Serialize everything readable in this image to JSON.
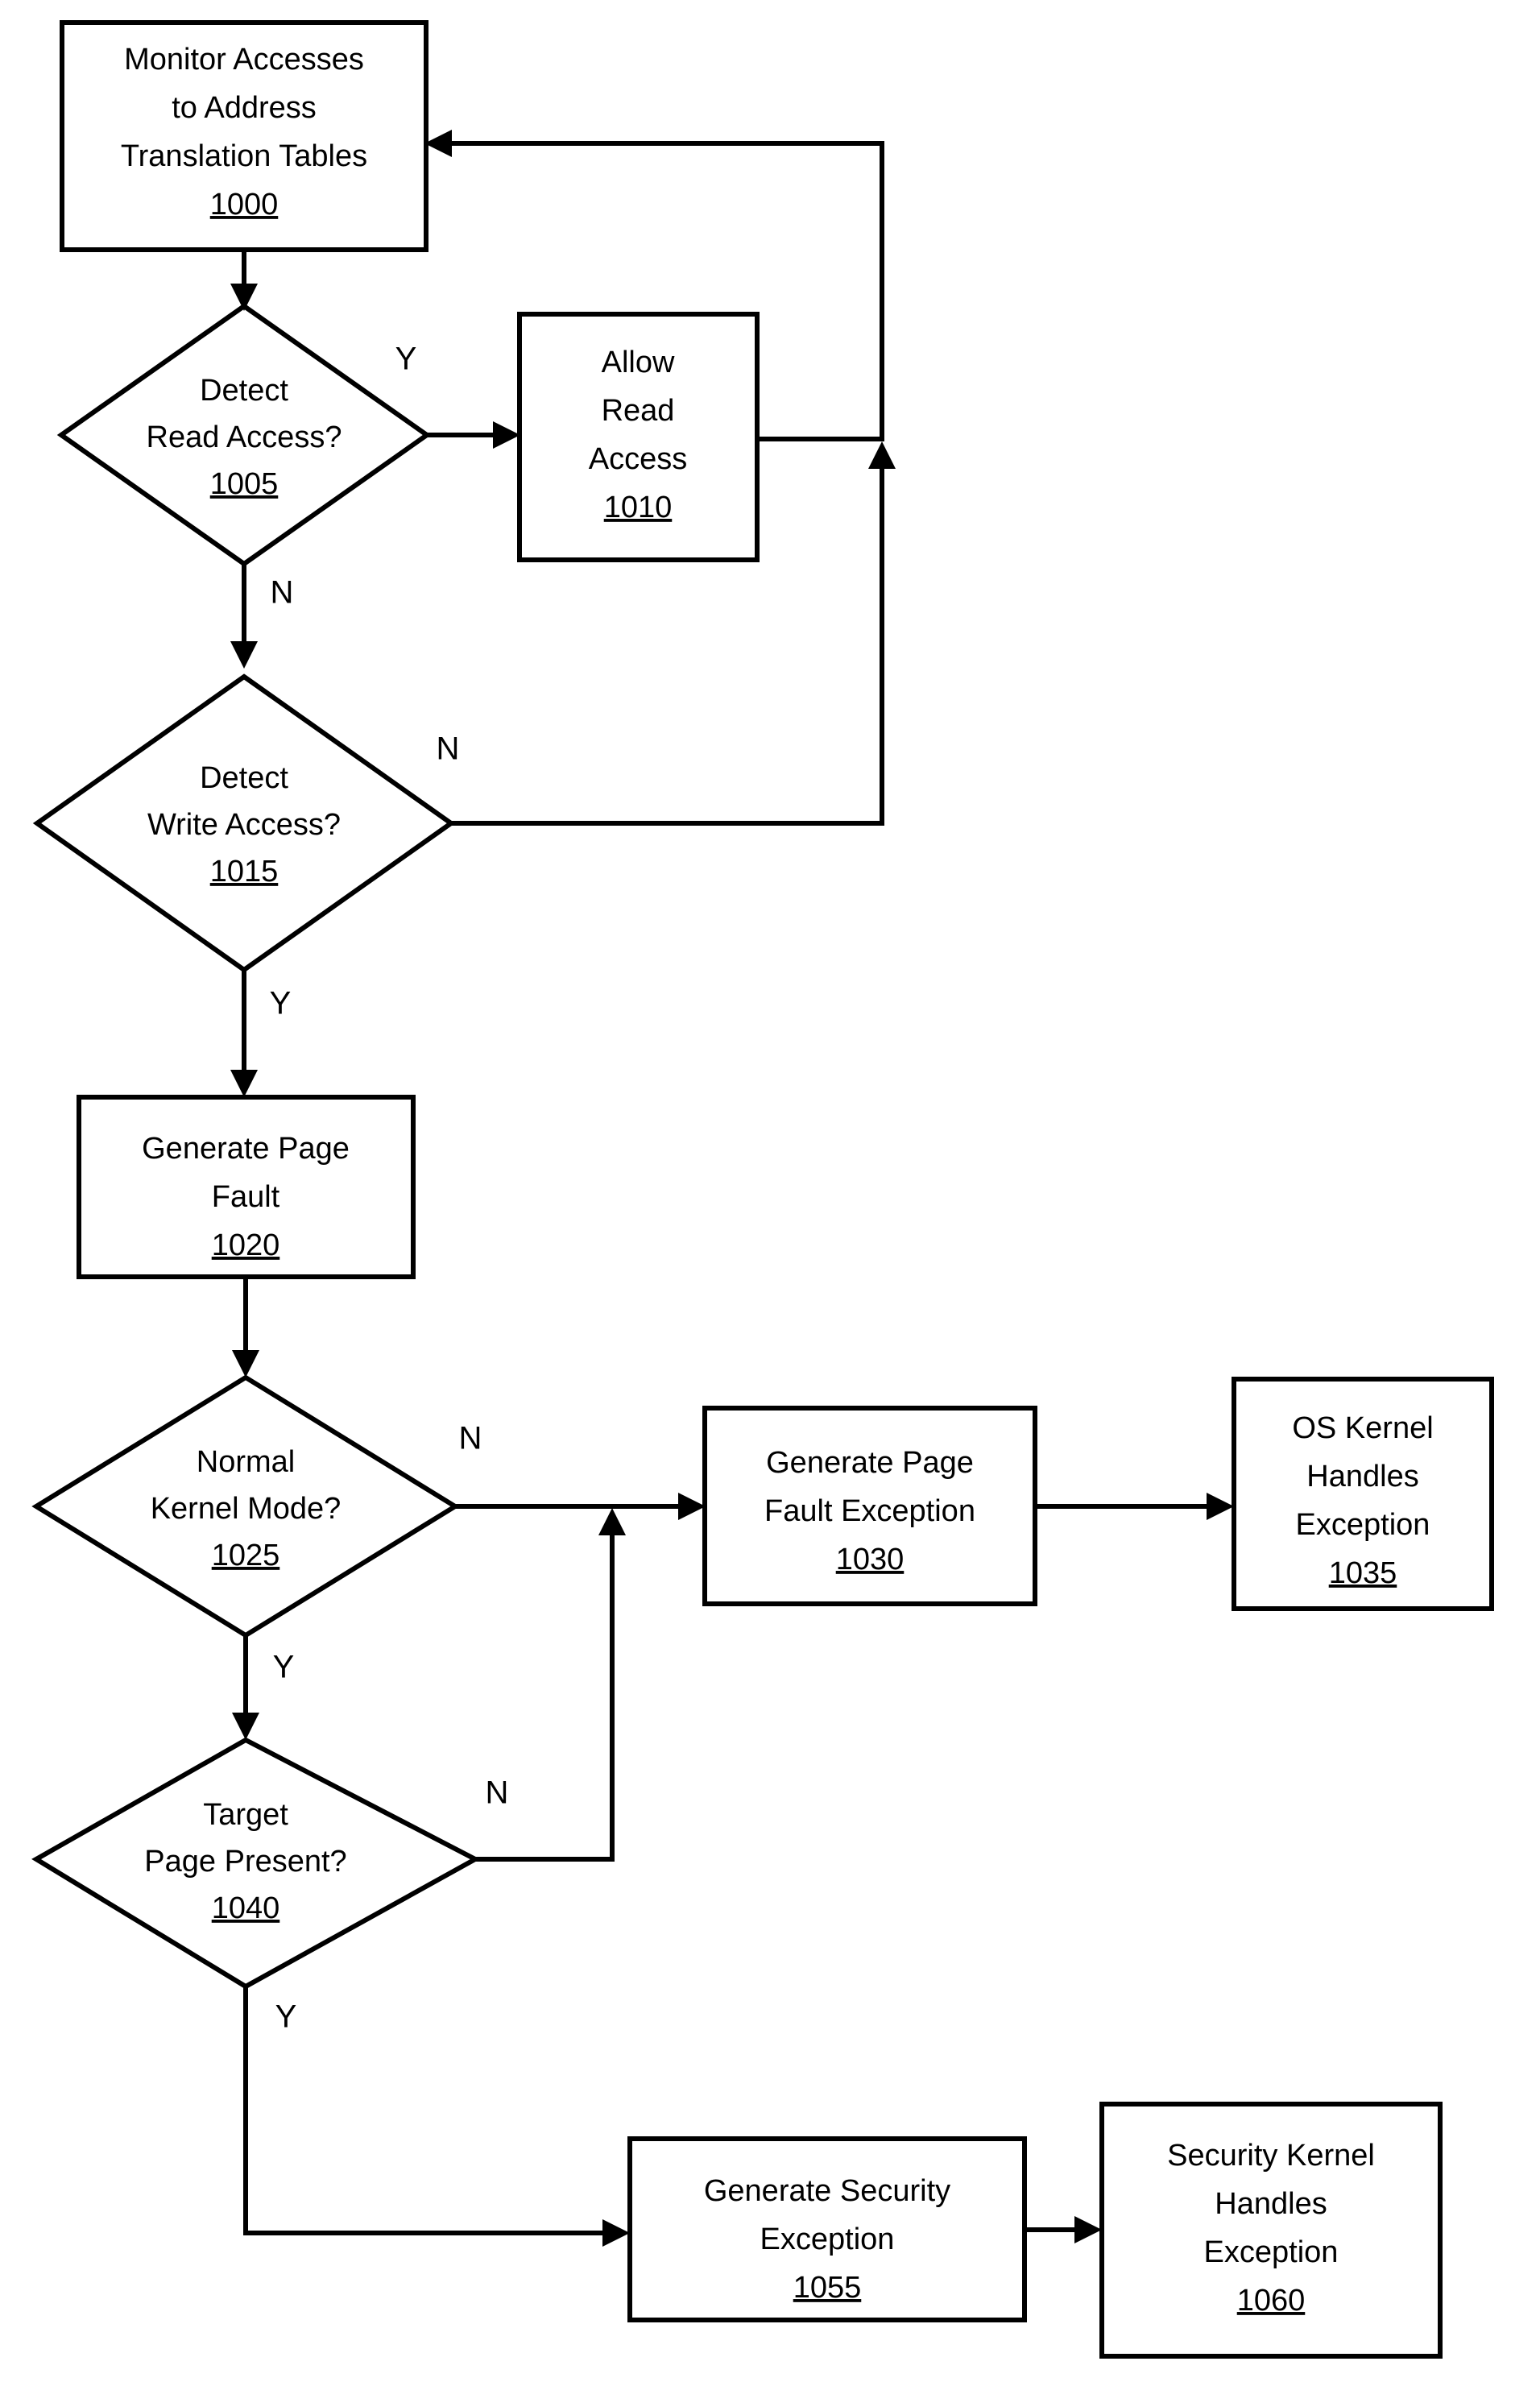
{
  "diagram": {
    "type": "flowchart",
    "orientation": "vertical",
    "line_color": "#000000",
    "fill_color": "#ffffff",
    "nodes": [
      {
        "id": "1000",
        "shape": "process",
        "lines": [
          "Monitor Accesses",
          "to Address",
          "Translation Tables"
        ],
        "ref": "1000"
      },
      {
        "id": "1005",
        "shape": "decision",
        "lines": [
          "Detect",
          "Read Access?"
        ],
        "ref": "1005"
      },
      {
        "id": "1010",
        "shape": "process",
        "lines": [
          "Allow",
          "Read",
          "Access"
        ],
        "ref": "1010"
      },
      {
        "id": "1015",
        "shape": "decision",
        "lines": [
          "Detect",
          "Write Access?"
        ],
        "ref": "1015"
      },
      {
        "id": "1020",
        "shape": "process",
        "lines": [
          "Generate Page",
          "Fault"
        ],
        "ref": "1020"
      },
      {
        "id": "1025",
        "shape": "decision",
        "lines": [
          "Normal",
          "Kernel Mode?"
        ],
        "ref": "1025"
      },
      {
        "id": "1030",
        "shape": "process",
        "lines": [
          "Generate Page",
          "Fault Exception"
        ],
        "ref": "1030"
      },
      {
        "id": "1035",
        "shape": "process",
        "lines": [
          "OS Kernel",
          "Handles",
          "Exception"
        ],
        "ref": "1035"
      },
      {
        "id": "1040",
        "shape": "decision",
        "lines": [
          "Target",
          "Page Present?"
        ],
        "ref": "1040"
      },
      {
        "id": "1055",
        "shape": "process",
        "lines": [
          "Generate Security",
          "Exception"
        ],
        "ref": "1055"
      },
      {
        "id": "1060",
        "shape": "process",
        "lines": [
          "Security Kernel",
          "Handles",
          "Exception"
        ],
        "ref": "1060"
      }
    ],
    "edges": [
      {
        "id": "e-1000-1005",
        "from": "1000",
        "to": "1005",
        "label": ""
      },
      {
        "id": "e-1005-1010",
        "from": "1005",
        "to": "1010",
        "label": "Y"
      },
      {
        "id": "e-1005-1015",
        "from": "1005",
        "to": "1015",
        "label": "N"
      },
      {
        "id": "e-1010-1000",
        "from": "1010",
        "to": "1000",
        "label": ""
      },
      {
        "id": "e-1015-1000",
        "from": "1015",
        "to": "1000",
        "label": "N"
      },
      {
        "id": "e-1015-1020",
        "from": "1015",
        "to": "1020",
        "label": "Y"
      },
      {
        "id": "e-1020-1025",
        "from": "1020",
        "to": "1025",
        "label": ""
      },
      {
        "id": "e-1025-1030",
        "from": "1025",
        "to": "1030",
        "label": "N"
      },
      {
        "id": "e-1030-1035",
        "from": "1030",
        "to": "1035",
        "label": ""
      },
      {
        "id": "e-1025-1040",
        "from": "1025",
        "to": "1040",
        "label": "Y"
      },
      {
        "id": "e-1040-1030",
        "from": "1040",
        "to": "1030",
        "label": "N"
      },
      {
        "id": "e-1040-1055",
        "from": "1040",
        "to": "1055",
        "label": "Y"
      },
      {
        "id": "e-1055-1060",
        "from": "1055",
        "to": "1060",
        "label": ""
      }
    ]
  },
  "labels": {
    "n1000_l0": "Monitor Accesses",
    "n1000_l1": "to Address",
    "n1000_l2": "Translation Tables",
    "n1000_ref": "1000",
    "n1005_l0": "Detect",
    "n1005_l1": "Read Access?",
    "n1005_ref": "1005",
    "n1010_l0": "Allow",
    "n1010_l1": "Read",
    "n1010_l2": "Access",
    "n1010_ref": "1010",
    "n1015_l0": "Detect",
    "n1015_l1": "Write Access?",
    "n1015_ref": "1015",
    "n1020_l0": "Generate Page",
    "n1020_l1": "Fault",
    "n1020_ref": "1020",
    "n1025_l0": "Normal",
    "n1025_l1": "Kernel Mode?",
    "n1025_ref": "1025",
    "n1030_l0": "Generate Page",
    "n1030_l1": "Fault Exception",
    "n1030_ref": "1030",
    "n1035_l0": "OS Kernel",
    "n1035_l1": "Handles",
    "n1035_l2": "Exception",
    "n1035_ref": "1035",
    "n1040_l0": "Target",
    "n1040_l1": "Page Present?",
    "n1040_ref": "1040",
    "n1055_l0": "Generate Security",
    "n1055_l1": "Exception",
    "n1055_ref": "1055",
    "n1060_l0": "Security Kernel",
    "n1060_l1": "Handles",
    "n1060_l2": "Exception",
    "n1060_ref": "1060",
    "branch_1005_yes": "Y",
    "branch_1005_no": "N",
    "branch_1015_no": "N",
    "branch_1015_yes": "Y",
    "branch_1025_no": "N",
    "branch_1025_yes": "Y",
    "branch_1040_no": "N",
    "branch_1040_yes": "Y"
  }
}
